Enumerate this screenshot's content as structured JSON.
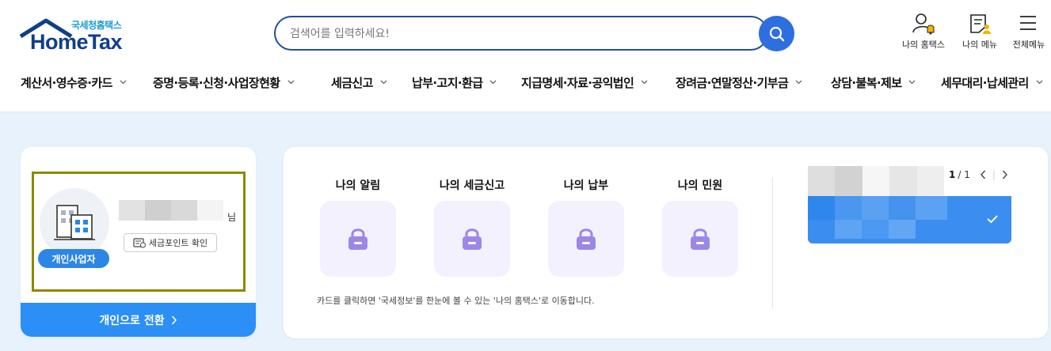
{
  "header": {
    "logo_small": "국세청홈택스",
    "logo_big": "HomeTax",
    "search_placeholder": "검색어를 입력하세요!",
    "utils": [
      {
        "label": "나의 홈택스",
        "icon": "user-bell-icon"
      },
      {
        "label": "나의 메뉴",
        "icon": "my-menu-icon"
      },
      {
        "label": "전체메뉴",
        "icon": "hamburger-icon"
      }
    ]
  },
  "nav": [
    "계산서·영수증·카드",
    "증명·등록·신청·사업장현황",
    "세금신고",
    "납부·고지·환급",
    "지급명세·자료·공익법인",
    "장려금·연말정산·기부금",
    "상담·불복·제보",
    "세무대리·납세관리"
  ],
  "profile": {
    "name_suffix": "님",
    "badge": "개인사업자",
    "point_button": "세금포인트 확인",
    "switch_button": "개인으로 전환"
  },
  "tiles": [
    {
      "title": "나의 알림",
      "icon": "lock-icon"
    },
    {
      "title": "나의 세금신고",
      "icon": "lock-icon"
    },
    {
      "title": "나의 납부",
      "icon": "lock-icon"
    },
    {
      "title": "나의 민원",
      "icon": "lock-icon"
    }
  ],
  "notice": "카드를 클릭하면 '국세정보'를 한눈에 볼 수 있는 '나의 홈택스'로 이동합니다.",
  "pager": {
    "current": "1",
    "total": "/ 1"
  },
  "colors": {
    "brand_navy": "#0f3e8a",
    "accent_blue": "#2b8ff5",
    "background": "#e8f2fc",
    "tile_bg": "#f3f1fe",
    "lock": "#9b87e8"
  }
}
